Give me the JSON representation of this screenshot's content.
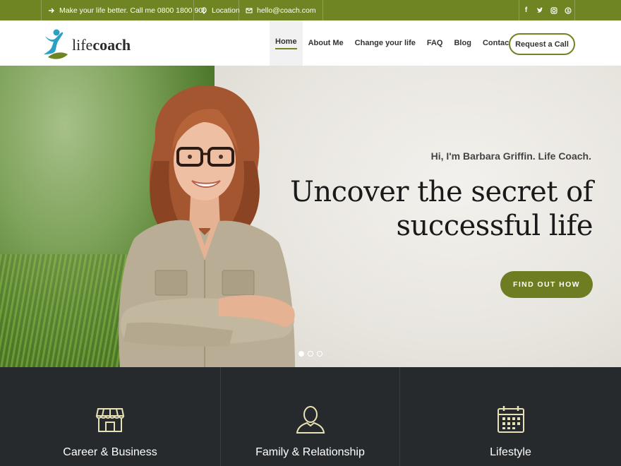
{
  "topbar": {
    "phone_text": "Make your life better. Call me 0800 1800 900",
    "location_text": "Location",
    "email_text": "hello@coach.com",
    "socials": [
      "f",
      "t",
      "ig",
      "s"
    ]
  },
  "header": {
    "logo_light": "life",
    "logo_bold": "coach",
    "nav": [
      {
        "label": "Home",
        "active": true
      },
      {
        "label": "About Me"
      },
      {
        "label": "Change your life"
      },
      {
        "label": "FAQ"
      },
      {
        "label": "Blog"
      },
      {
        "label": "Contact"
      }
    ],
    "request_label": "Request a Call"
  },
  "hero": {
    "subtitle": "Hi, I'm Barbara Griffin. Life Coach.",
    "title_line1": "Uncover the secret of",
    "title_line2": "successful life",
    "cta_label": "FIND OUT HOW",
    "slides": 3,
    "active_slide": 1
  },
  "features": [
    {
      "title": "Career & Business",
      "icon": "storefront-icon"
    },
    {
      "title": "Family & Relationship",
      "icon": "person-icon"
    },
    {
      "title": "Lifestyle",
      "icon": "calendar-icon"
    }
  ],
  "colors": {
    "accent": "#6f8423",
    "dark": "#272a2c",
    "icon": "#e9e1b6"
  }
}
